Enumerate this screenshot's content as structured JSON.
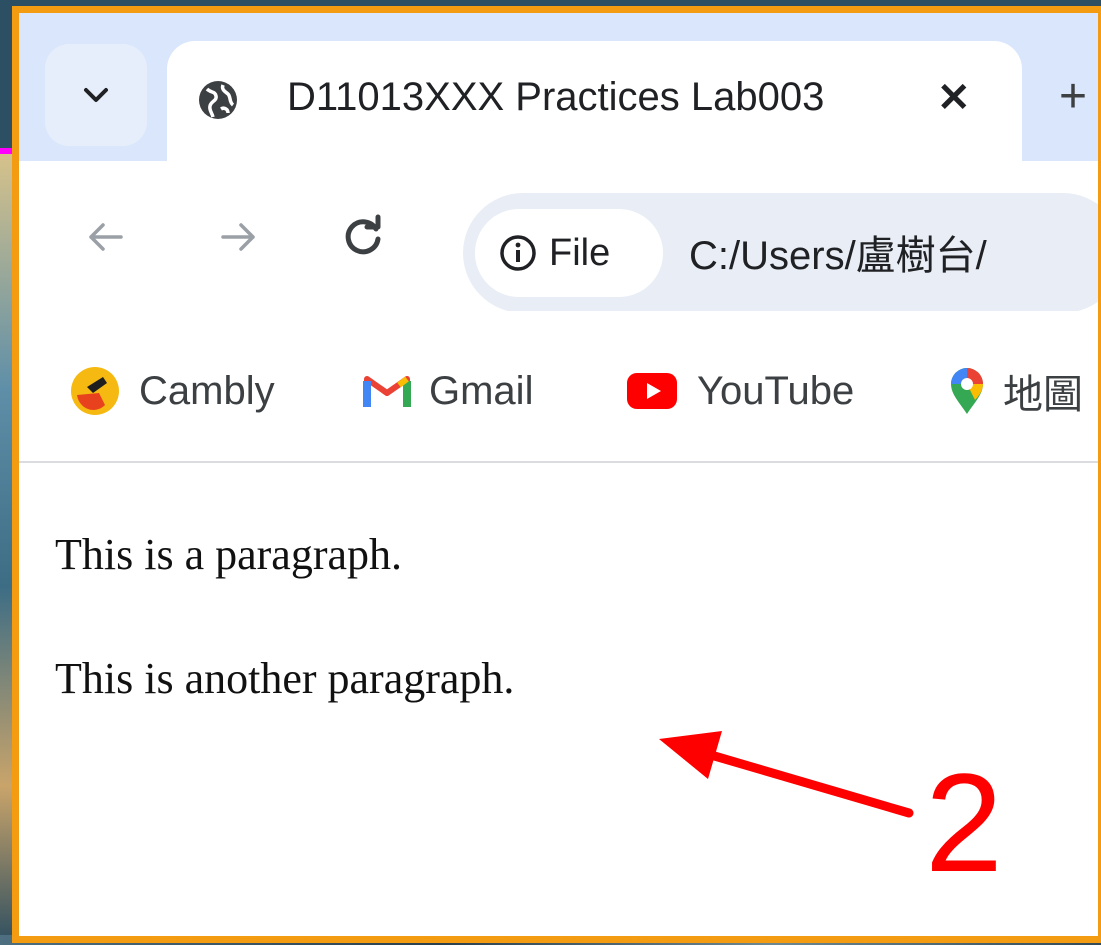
{
  "tab": {
    "title": "D11013XXX Practices Lab003",
    "close_glyph": "✕",
    "new_tab_glyph": "+"
  },
  "toolbar": {
    "site_chip_label": "File",
    "url": "C:/Users/盧樹台/"
  },
  "bookmarks": [
    {
      "label": "Cambly",
      "icon": "cambly-icon"
    },
    {
      "label": "Gmail",
      "icon": "gmail-icon"
    },
    {
      "label": "YouTube",
      "icon": "youtube-icon"
    },
    {
      "label": "地圖",
      "icon": "maps-pin-icon"
    }
  ],
  "content": {
    "paragraphs": [
      "This is a paragraph.",
      "This is another paragraph."
    ]
  },
  "annotation": {
    "number": "2",
    "color": "#ff0000"
  },
  "colors": {
    "frame_border": "#f39c12",
    "tabstrip_bg": "#d9e6fb",
    "omnibox_bg": "#e9eef6"
  }
}
